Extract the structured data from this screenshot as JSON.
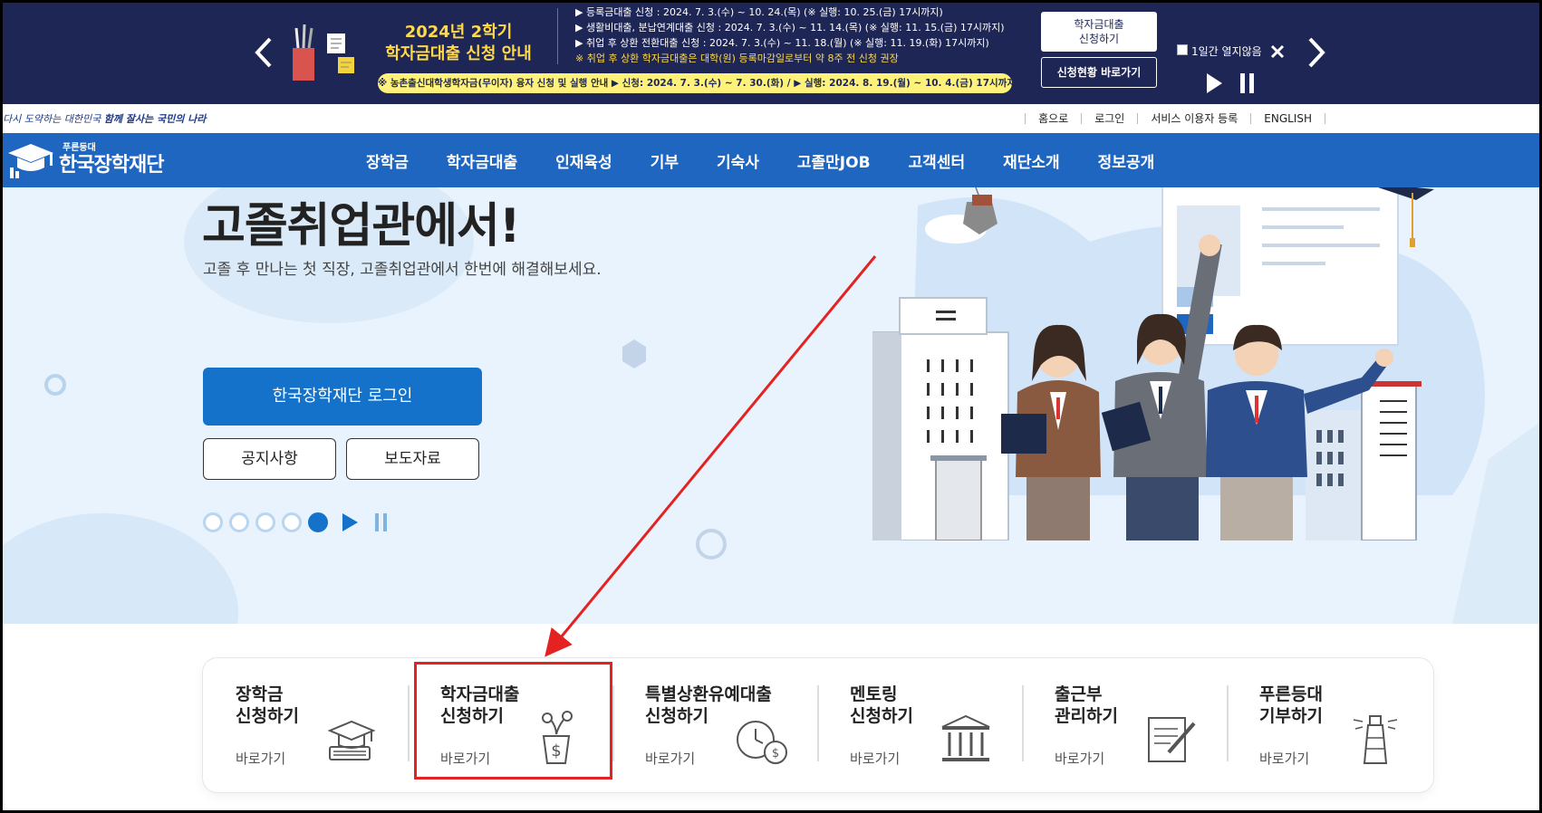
{
  "banner": {
    "title_line1": "2024년 2학기",
    "title_line2": "학자금대출 신청 안내",
    "lines": [
      "▶ 등록금대출 신청 : 2024. 7. 3.(수) ~ 10. 24.(목) (※ 실행: 10. 25.(금) 17시까지)",
      "▶ 생활비대출, 분납연계대출 신청 : 2024. 7. 3.(수) ~ 11. 14.(목) (※ 실행: 11. 15.(금) 17시까지)",
      "▶ 취업 후 상환 전환대출 신청 : 2024. 7. 3.(수) ~ 11. 18.(월) (※ 실행: 11. 19.(화) 17시까지)"
    ],
    "warning": "※ 취업 후 상환 학자금대출은 대학(원) 등록마감일로부터 약 8주 전 신청 권장",
    "pill": "※ 농촌출신대학생학자금(무이자) 융자 신청 및 실행 안내 ▶ 신청: 2024. 7. 3.(수) ~ 7. 30.(화) / ▶ 실행: 2024. 8. 19.(월) ~ 10. 4.(금) 17시까지",
    "apply_btn_line1": "학자금대출",
    "apply_btn_line2": "신청하기",
    "status_btn": "신청현황 바로가기",
    "hide_label": "1일간 열지않음",
    "accent": "#ffd94a",
    "bg": "#1e2655"
  },
  "util": {
    "slogan_a": "다시 도약하는 대한민국",
    "slogan_b": "함께 잘사는 국민의 나라",
    "links": [
      "홈으로",
      "로그인",
      "서비스 이용자 등록",
      "ENGLISH"
    ]
  },
  "gnb": {
    "logo_sub": "푸른등대",
    "logo_main": "한국장학재단",
    "menu": [
      "장학금",
      "학자금대출",
      "인재육성",
      "기부",
      "기숙사",
      "고졸만JOB",
      "고객센터",
      "재단소개",
      "정보공개"
    ],
    "bg": "#1f66c1"
  },
  "hero": {
    "title": "고졸취업관에서!",
    "subtitle": "고졸 후 만나는 첫 직장, 고졸취업관에서 한번에 해결해보세요.",
    "login_btn": "한국장학재단 로그인",
    "notice_btn": "공지사항",
    "press_btn": "보도자료",
    "slides_total": 5,
    "slide_active": 5
  },
  "quick": [
    {
      "line1": "장학금",
      "line2": "신청하기",
      "link": "바로가기",
      "icon": "graduation-cap-icon"
    },
    {
      "line1": "학자금대출",
      "line2": "신청하기",
      "link": "바로가기",
      "icon": "money-bag-icon"
    },
    {
      "line1": "특별상환유예대출",
      "line2": "신청하기",
      "link": "바로가기",
      "icon": "clock-coin-icon"
    },
    {
      "line1": "멘토링",
      "line2": "신청하기",
      "link": "바로가기",
      "icon": "institution-icon"
    },
    {
      "line1": "출근부",
      "line2": "관리하기",
      "link": "바로가기",
      "icon": "notepad-pen-icon"
    },
    {
      "line1": "푸른등대",
      "line2": "기부하기",
      "link": "바로가기",
      "icon": "lighthouse-icon"
    }
  ],
  "annotation": {
    "color": "#e52222"
  }
}
